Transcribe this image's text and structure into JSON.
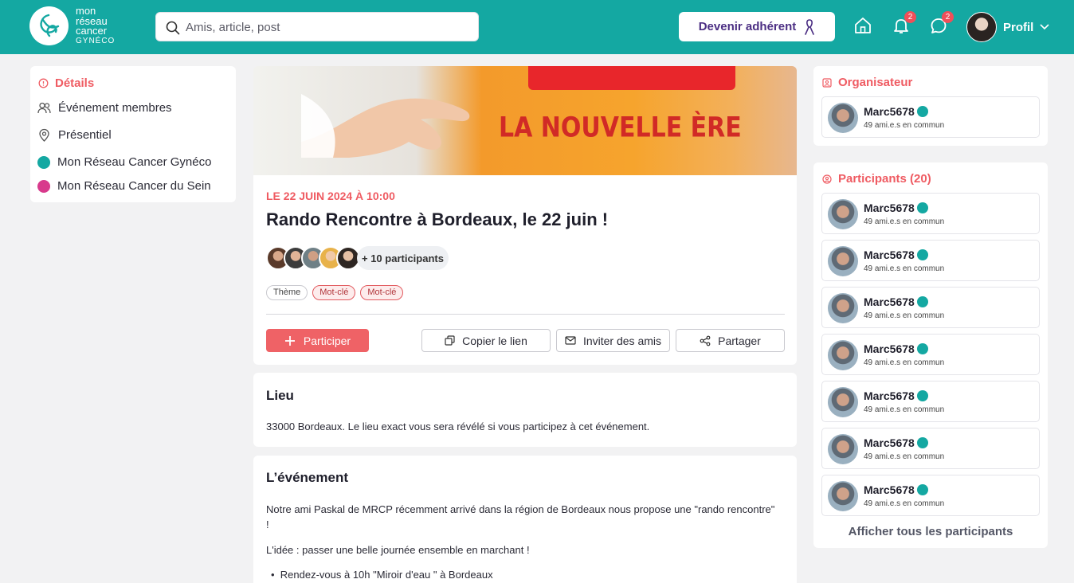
{
  "header": {
    "logo_lines": [
      "mon",
      "réseau",
      "cancer",
      "GYNÉCO"
    ],
    "search_placeholder": "Amis, article, post",
    "adherent_label": "Devenir adhérent",
    "notifications_count": "2",
    "messages_count": "2",
    "profile_label": "Profil"
  },
  "left": {
    "details_label": "Détails",
    "items": [
      {
        "label": "Événement membres",
        "icon": "users-icon"
      },
      {
        "label": "Présentiel",
        "icon": "location-pin-icon"
      },
      {
        "label": "Mon Réseau Cancer Gynéco",
        "icon": "network-gyneco-icon",
        "color": "#14a8a2"
      },
      {
        "label": "Mon Réseau Cancer du Sein",
        "icon": "network-sein-icon",
        "color": "#d83a8c"
      }
    ]
  },
  "hero": {
    "text": "LA NOUVELLE ÈRE"
  },
  "event": {
    "date": "LE 22 JUIN 2024 À 10:00",
    "title": "Rando Rencontre à Bordeaux, le 22 juin !",
    "participants_more": "+ 10 participants",
    "tags": [
      "Thème",
      "Mot-clé",
      "Mot-clé"
    ],
    "participer_label": "Participer",
    "copy_label": "Copier le lien",
    "invite_label": "Inviter des amis",
    "share_label": "Partager"
  },
  "lieu": {
    "title": "Lieu",
    "text": "33000 Bordeaux. Le lieu exact vous sera révélé si vous participez à cet événement."
  },
  "description": {
    "title": "L’événement",
    "paragraph1": "Notre ami Paskal de MRCP récemment arrivé dans la région de Bordeaux nous propose une \"rando rencontre\" !",
    "paragraph2": "L'idée : passer une belle journée ensemble en marchant !",
    "bullet1": "Rendez-vous à 10h \"Miroir d'eau \" à Bordeaux"
  },
  "organizer": {
    "title": "Organisateur",
    "name": "Marc5678",
    "common": "49 ami.e.s en commun"
  },
  "participants": {
    "title": "Participants (20)",
    "list": [
      {
        "name": "Marc5678",
        "common": "49 ami.e.s en commun"
      },
      {
        "name": "Marc5678",
        "common": "49 ami.e.s en commun"
      },
      {
        "name": "Marc5678",
        "common": "49 ami.e.s en commun"
      },
      {
        "name": "Marc5678",
        "common": "49 ami.e.s en commun"
      },
      {
        "name": "Marc5678",
        "common": "49 ami.e.s en commun"
      },
      {
        "name": "Marc5678",
        "common": "49 ami.e.s en commun"
      },
      {
        "name": "Marc5678",
        "common": "49 ami.e.s en commun"
      }
    ],
    "show_all": "Afficher tous les participants"
  },
  "colors": {
    "brand": "#14a8a2",
    "accent": "#ef5b62",
    "adherent": "#4b2e83"
  }
}
